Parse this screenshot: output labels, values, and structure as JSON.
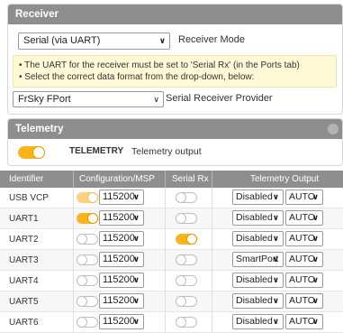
{
  "receiver": {
    "title": "Receiver",
    "mode_value": "Serial (via UART)",
    "mode_label": "Receiver Mode",
    "notes": [
      "• The UART for the receiver must be set to 'Serial Rx' (in the Ports tab)",
      "• Select the correct data format from the drop-down, below:"
    ],
    "provider_value": "FrSky FPort",
    "provider_label": "Serial Receiver Provider"
  },
  "telemetry": {
    "title": "Telemetry",
    "toggle_label": "TELEMETRY",
    "toggle_desc": "Telemetry output",
    "enabled": true
  },
  "ports": {
    "headers": [
      "Identifier",
      "Configuration/MSP",
      "Serial Rx",
      "Telemetry Output"
    ],
    "rows": [
      {
        "id": "USB VCP",
        "msp": "on-light",
        "baud": "115200",
        "serial_rx": false,
        "telemetry": "Disabled",
        "auto": "AUTO"
      },
      {
        "id": "UART1",
        "msp": "on",
        "baud": "115200",
        "serial_rx": false,
        "telemetry": "Disabled",
        "auto": "AUTO"
      },
      {
        "id": "UART2",
        "msp": "off",
        "baud": "115200",
        "serial_rx": true,
        "telemetry": "Disabled",
        "auto": "AUTO"
      },
      {
        "id": "UART3",
        "msp": "off",
        "baud": "115200",
        "serial_rx": false,
        "telemetry": "SmartPort",
        "auto": "AUTO"
      },
      {
        "id": "UART4",
        "msp": "off",
        "baud": "115200",
        "serial_rx": false,
        "telemetry": "Disabled",
        "auto": "AUTO"
      },
      {
        "id": "UART5",
        "msp": "off",
        "baud": "115200",
        "serial_rx": false,
        "telemetry": "Disabled",
        "auto": "AUTO"
      },
      {
        "id": "UART6",
        "msp": "off",
        "baud": "115200",
        "serial_rx": false,
        "telemetry": "Disabled",
        "auto": "AUTO"
      }
    ]
  },
  "colors": {
    "header_bg": "#8e8e8e",
    "toggle_on": "#ffb31a",
    "note_bg": "#fff9d6"
  },
  "icons": {
    "dropdown": "chevron-down-icon",
    "close": "close-icon"
  }
}
